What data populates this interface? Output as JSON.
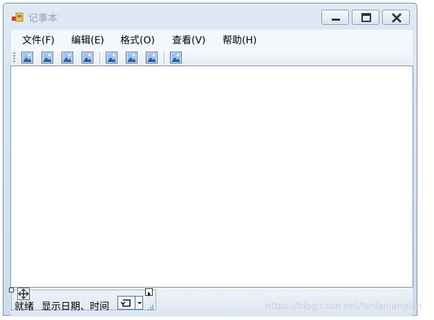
{
  "window": {
    "title": "记事本"
  },
  "menu": {
    "items": [
      {
        "label": "文件(F)"
      },
      {
        "label": "编辑(E)"
      },
      {
        "label": "格式(O)"
      },
      {
        "label": "查看(V)"
      },
      {
        "label": "帮助(H)"
      }
    ]
  },
  "toolbar": {
    "buttons": [
      "image-icon",
      "image-icon",
      "image-icon",
      "image-icon",
      "image-icon",
      "image-icon",
      "image-icon",
      "image-icon"
    ]
  },
  "editor": {
    "content": ""
  },
  "status": {
    "ready_label": "就绪",
    "datetime_label": "显示日期、时间"
  },
  "watermark": {
    "text": "https://blog.csdn.net/lanlanlanglan"
  },
  "colors": {
    "frame": "#cfdcec",
    "border": "#7a8ea8",
    "title_text": "#9aa3ad"
  }
}
